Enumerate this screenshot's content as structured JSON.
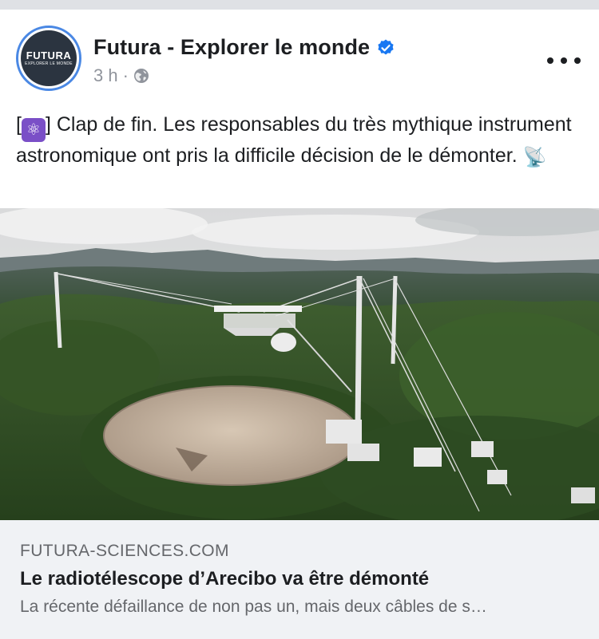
{
  "post": {
    "page_name": "Futura - Explorer le monde",
    "avatar": {
      "logo_text": "FUTURA",
      "logo_subtext": "EXPLORER LE MONDE"
    },
    "timestamp": "3 h",
    "separator": "·",
    "audience_icon": "globe-icon",
    "verified_icon": "verified-badge-icon",
    "more_icon": "more-options-icon",
    "text": {
      "open_bracket": "[",
      "badge_icon": "atom-emoji",
      "badge_glyph": "⚛",
      "body": "] Clap de fin. Les responsables du très mythique instrument astronomique ont pris la difficile décision de le démonter. ",
      "trailing_emoji": "📡"
    }
  },
  "link_preview": {
    "domain": "FUTURA-SCIENCES.COM",
    "title": "Le radiotélescope d’Arecibo va être démonté",
    "description": "La récente défaillance de non pas un, mais deux câbles de s…"
  },
  "colors": {
    "accent_blue": "#1877f2",
    "separator_grey": "#dfe1e5",
    "preview_bg": "#f0f2f5",
    "secondary_text": "#65676b"
  }
}
